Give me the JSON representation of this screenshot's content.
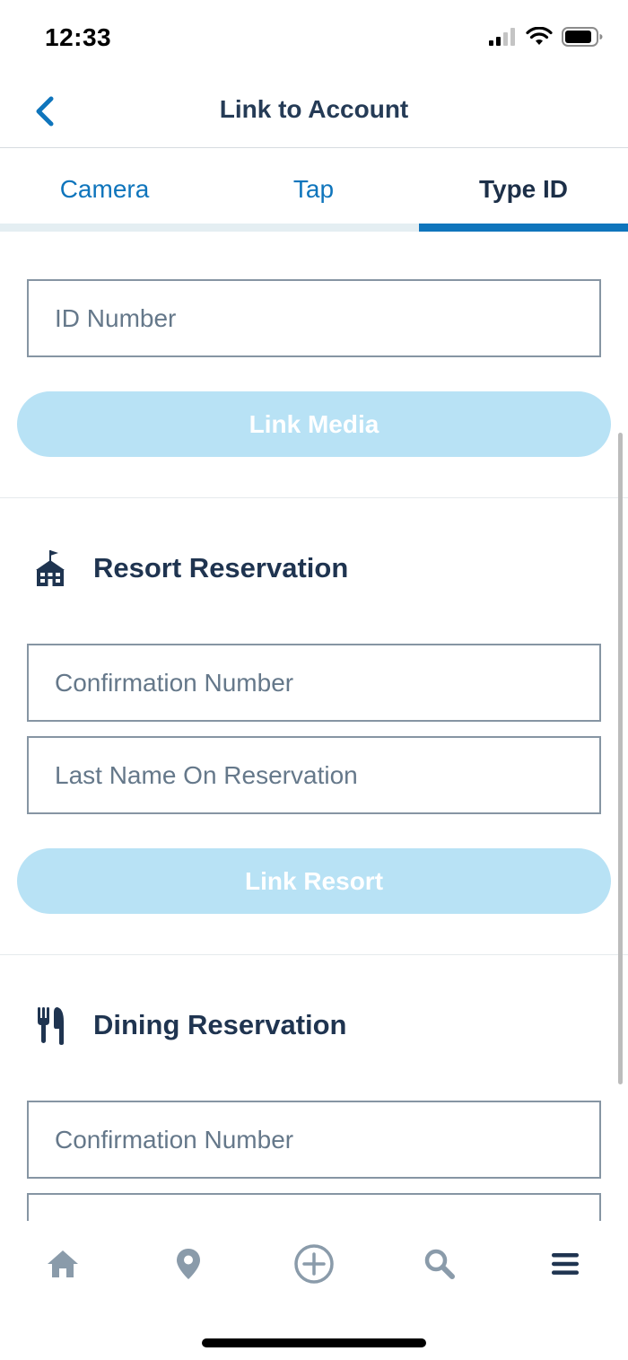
{
  "status_bar": {
    "time": "12:33"
  },
  "nav": {
    "title": "Link to Account",
    "back_icon": "chevron-left-icon"
  },
  "tabs": [
    {
      "label": "Camera",
      "active": false
    },
    {
      "label": "Tap",
      "active": false
    },
    {
      "label": "Type ID",
      "active": true
    }
  ],
  "media": {
    "id_placeholder": "ID Number",
    "link_label": "Link Media"
  },
  "resort": {
    "title": "Resort Reservation",
    "icon": "hotel-icon",
    "confirmation_placeholder": "Confirmation Number",
    "last_name_placeholder": "Last Name On Reservation",
    "link_label": "Link Resort"
  },
  "dining": {
    "title": "Dining Reservation",
    "icon": "fork-knife-icon",
    "confirmation_placeholder": "Confirmation Number"
  },
  "tab_bar": [
    "home-icon",
    "location-pin-icon",
    "add-circle-icon",
    "search-icon",
    "menu-icon"
  ],
  "colors": {
    "accent": "#0f75bc",
    "title": "#253b56",
    "button_disabled": "#b8e2f5",
    "tab_track": "#e4eef2",
    "field_border": "#8695a3",
    "placeholder": "#65788a",
    "tab_bar_icon": "#8a9baa"
  }
}
